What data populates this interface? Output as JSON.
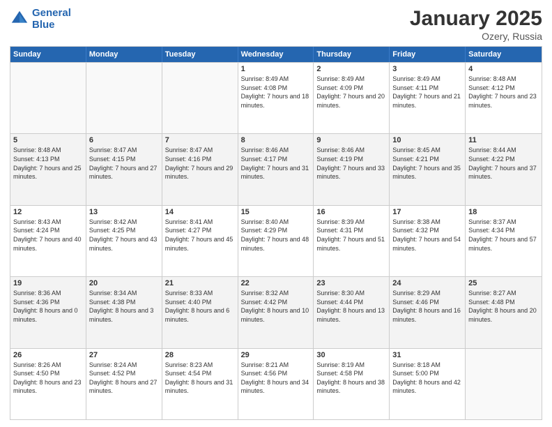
{
  "logo": {
    "line1": "General",
    "line2": "Blue"
  },
  "title": "January 2025",
  "location": "Ozery, Russia",
  "days_of_week": [
    "Sunday",
    "Monday",
    "Tuesday",
    "Wednesday",
    "Thursday",
    "Friday",
    "Saturday"
  ],
  "weeks": [
    [
      {
        "day": "",
        "sunrise": "",
        "sunset": "",
        "daylight": ""
      },
      {
        "day": "",
        "sunrise": "",
        "sunset": "",
        "daylight": ""
      },
      {
        "day": "",
        "sunrise": "",
        "sunset": "",
        "daylight": ""
      },
      {
        "day": "1",
        "sunrise": "Sunrise: 8:49 AM",
        "sunset": "Sunset: 4:08 PM",
        "daylight": "Daylight: 7 hours and 18 minutes."
      },
      {
        "day": "2",
        "sunrise": "Sunrise: 8:49 AM",
        "sunset": "Sunset: 4:09 PM",
        "daylight": "Daylight: 7 hours and 20 minutes."
      },
      {
        "day": "3",
        "sunrise": "Sunrise: 8:49 AM",
        "sunset": "Sunset: 4:11 PM",
        "daylight": "Daylight: 7 hours and 21 minutes."
      },
      {
        "day": "4",
        "sunrise": "Sunrise: 8:48 AM",
        "sunset": "Sunset: 4:12 PM",
        "daylight": "Daylight: 7 hours and 23 minutes."
      }
    ],
    [
      {
        "day": "5",
        "sunrise": "Sunrise: 8:48 AM",
        "sunset": "Sunset: 4:13 PM",
        "daylight": "Daylight: 7 hours and 25 minutes."
      },
      {
        "day": "6",
        "sunrise": "Sunrise: 8:47 AM",
        "sunset": "Sunset: 4:15 PM",
        "daylight": "Daylight: 7 hours and 27 minutes."
      },
      {
        "day": "7",
        "sunrise": "Sunrise: 8:47 AM",
        "sunset": "Sunset: 4:16 PM",
        "daylight": "Daylight: 7 hours and 29 minutes."
      },
      {
        "day": "8",
        "sunrise": "Sunrise: 8:46 AM",
        "sunset": "Sunset: 4:17 PM",
        "daylight": "Daylight: 7 hours and 31 minutes."
      },
      {
        "day": "9",
        "sunrise": "Sunrise: 8:46 AM",
        "sunset": "Sunset: 4:19 PM",
        "daylight": "Daylight: 7 hours and 33 minutes."
      },
      {
        "day": "10",
        "sunrise": "Sunrise: 8:45 AM",
        "sunset": "Sunset: 4:21 PM",
        "daylight": "Daylight: 7 hours and 35 minutes."
      },
      {
        "day": "11",
        "sunrise": "Sunrise: 8:44 AM",
        "sunset": "Sunset: 4:22 PM",
        "daylight": "Daylight: 7 hours and 37 minutes."
      }
    ],
    [
      {
        "day": "12",
        "sunrise": "Sunrise: 8:43 AM",
        "sunset": "Sunset: 4:24 PM",
        "daylight": "Daylight: 7 hours and 40 minutes."
      },
      {
        "day": "13",
        "sunrise": "Sunrise: 8:42 AM",
        "sunset": "Sunset: 4:25 PM",
        "daylight": "Daylight: 7 hours and 43 minutes."
      },
      {
        "day": "14",
        "sunrise": "Sunrise: 8:41 AM",
        "sunset": "Sunset: 4:27 PM",
        "daylight": "Daylight: 7 hours and 45 minutes."
      },
      {
        "day": "15",
        "sunrise": "Sunrise: 8:40 AM",
        "sunset": "Sunset: 4:29 PM",
        "daylight": "Daylight: 7 hours and 48 minutes."
      },
      {
        "day": "16",
        "sunrise": "Sunrise: 8:39 AM",
        "sunset": "Sunset: 4:31 PM",
        "daylight": "Daylight: 7 hours and 51 minutes."
      },
      {
        "day": "17",
        "sunrise": "Sunrise: 8:38 AM",
        "sunset": "Sunset: 4:32 PM",
        "daylight": "Daylight: 7 hours and 54 minutes."
      },
      {
        "day": "18",
        "sunrise": "Sunrise: 8:37 AM",
        "sunset": "Sunset: 4:34 PM",
        "daylight": "Daylight: 7 hours and 57 minutes."
      }
    ],
    [
      {
        "day": "19",
        "sunrise": "Sunrise: 8:36 AM",
        "sunset": "Sunset: 4:36 PM",
        "daylight": "Daylight: 8 hours and 0 minutes."
      },
      {
        "day": "20",
        "sunrise": "Sunrise: 8:34 AM",
        "sunset": "Sunset: 4:38 PM",
        "daylight": "Daylight: 8 hours and 3 minutes."
      },
      {
        "day": "21",
        "sunrise": "Sunrise: 8:33 AM",
        "sunset": "Sunset: 4:40 PM",
        "daylight": "Daylight: 8 hours and 6 minutes."
      },
      {
        "day": "22",
        "sunrise": "Sunrise: 8:32 AM",
        "sunset": "Sunset: 4:42 PM",
        "daylight": "Daylight: 8 hours and 10 minutes."
      },
      {
        "day": "23",
        "sunrise": "Sunrise: 8:30 AM",
        "sunset": "Sunset: 4:44 PM",
        "daylight": "Daylight: 8 hours and 13 minutes."
      },
      {
        "day": "24",
        "sunrise": "Sunrise: 8:29 AM",
        "sunset": "Sunset: 4:46 PM",
        "daylight": "Daylight: 8 hours and 16 minutes."
      },
      {
        "day": "25",
        "sunrise": "Sunrise: 8:27 AM",
        "sunset": "Sunset: 4:48 PM",
        "daylight": "Daylight: 8 hours and 20 minutes."
      }
    ],
    [
      {
        "day": "26",
        "sunrise": "Sunrise: 8:26 AM",
        "sunset": "Sunset: 4:50 PM",
        "daylight": "Daylight: 8 hours and 23 minutes."
      },
      {
        "day": "27",
        "sunrise": "Sunrise: 8:24 AM",
        "sunset": "Sunset: 4:52 PM",
        "daylight": "Daylight: 8 hours and 27 minutes."
      },
      {
        "day": "28",
        "sunrise": "Sunrise: 8:23 AM",
        "sunset": "Sunset: 4:54 PM",
        "daylight": "Daylight: 8 hours and 31 minutes."
      },
      {
        "day": "29",
        "sunrise": "Sunrise: 8:21 AM",
        "sunset": "Sunset: 4:56 PM",
        "daylight": "Daylight: 8 hours and 34 minutes."
      },
      {
        "day": "30",
        "sunrise": "Sunrise: 8:19 AM",
        "sunset": "Sunset: 4:58 PM",
        "daylight": "Daylight: 8 hours and 38 minutes."
      },
      {
        "day": "31",
        "sunrise": "Sunrise: 8:18 AM",
        "sunset": "Sunset: 5:00 PM",
        "daylight": "Daylight: 8 hours and 42 minutes."
      },
      {
        "day": "",
        "sunrise": "",
        "sunset": "",
        "daylight": ""
      }
    ]
  ]
}
